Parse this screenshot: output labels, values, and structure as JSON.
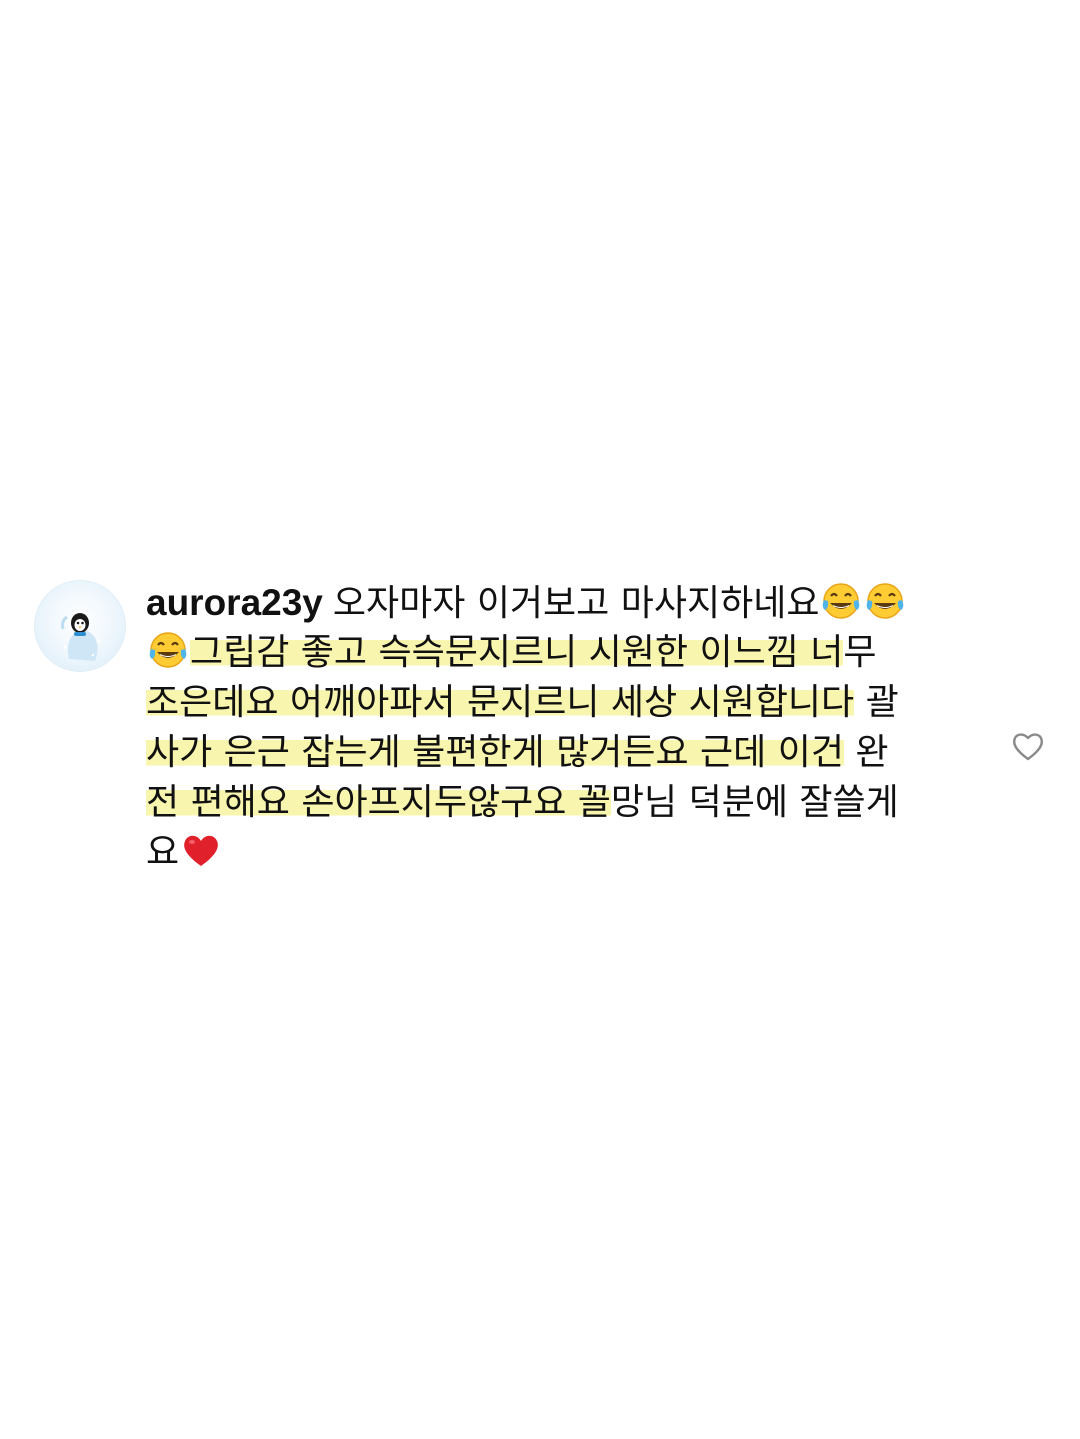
{
  "comment": {
    "username": "aurora23y",
    "lines": [
      {
        "pre": "오자마자 이거보고 마사지하네요",
        "emoji_after": [
          "tears-of-joy",
          "tears-of-joy"
        ]
      },
      {
        "emoji_before": "tears-of-joy",
        "highlighted": "그립감 좋고 슥슥문지르니 시원한 이느낌 너",
        "plain": "무"
      },
      {
        "highlighted": "조은데요 어깨아파서 문지르니 세상 시원합니다",
        "plain": " 괄"
      },
      {
        "highlighted": "사가 은근 잡는게 불편한게 많거든요 근데 이건",
        "plain": " 완"
      },
      {
        "highlighted": "전 편해요 손아프지두않구요 꼴",
        "plain": "망님 덕분에 잘쓸게"
      },
      {
        "plain": "요",
        "emoji_after": [
          "red-heart"
        ]
      }
    ]
  },
  "icons": {
    "avatar": "penguin-avatar-icon",
    "like": "heart-outline-icon"
  },
  "colors": {
    "highlight": "#f7f3a0",
    "text": "#111111",
    "heart_emoji": "#e0202a",
    "like_icon": "#8a8a8a"
  }
}
